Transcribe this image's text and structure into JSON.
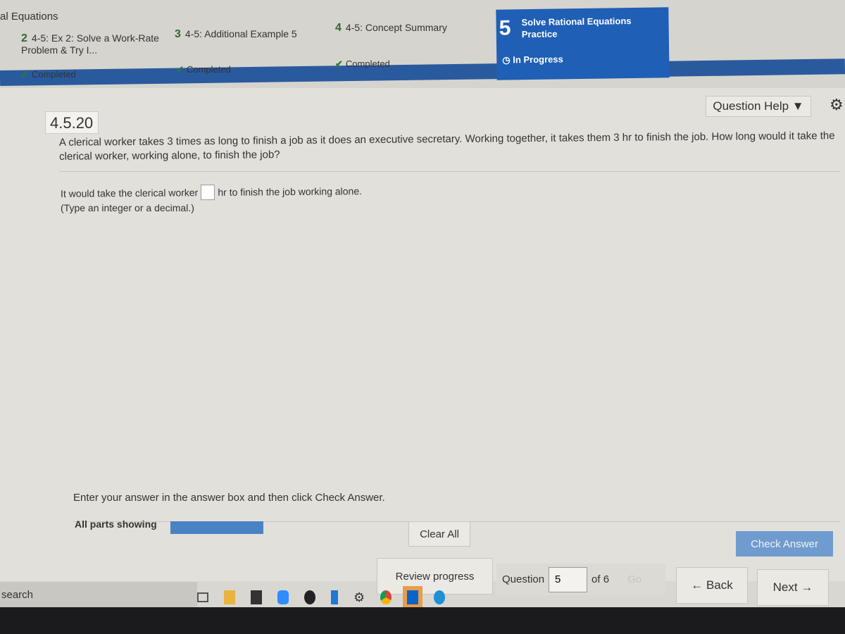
{
  "header": {
    "title": "al Equations",
    "tabs": [
      {
        "num": "2",
        "label": "4-5: Ex 2: Solve a Work-Rate Problem & Try I...",
        "status": "Completed"
      },
      {
        "num": "3",
        "label": "4-5: Additional Example 5",
        "status": "Completed"
      },
      {
        "num": "4",
        "label": "4-5: Concept Summary",
        "status": "Completed"
      },
      {
        "num": "5",
        "label": "Solve Rational Equations Practice",
        "status": "In Progress"
      }
    ]
  },
  "question": {
    "id": "4.5.20",
    "help_label": "Question Help ▼",
    "text": "A clerical worker takes 3 times as long to finish a job as it does an executive secretary. Working together, it takes them 3 hr to finish the job. How long would it take the clerical worker, working alone, to finish the job?",
    "answer_prefix": "It would take the clerical worker",
    "answer_value": "",
    "answer_suffix": "hr to finish the job working alone.",
    "hint": "(Type an integer or a decimal.)"
  },
  "footer": {
    "instruction": "Enter your answer in the answer box and then click Check Answer.",
    "parts_label": "All parts showing",
    "parts_progress": 1.0,
    "clear_all": "Clear All",
    "check_answer": "Check Answer",
    "review_progress": "Review progress",
    "question_label": "Question",
    "question_value": "5",
    "of_label": "of 6",
    "go": "Go",
    "back": "← Back",
    "next": "Next →"
  },
  "taskbar": {
    "search": "search",
    "icons": [
      "task-view-icon",
      "file-explorer-icon",
      "store-icon",
      "zoom-icon",
      "xbox-icon",
      "app-icon",
      "settings-icon",
      "chrome-icon",
      "outlook-icon",
      "edge-icon"
    ]
  }
}
